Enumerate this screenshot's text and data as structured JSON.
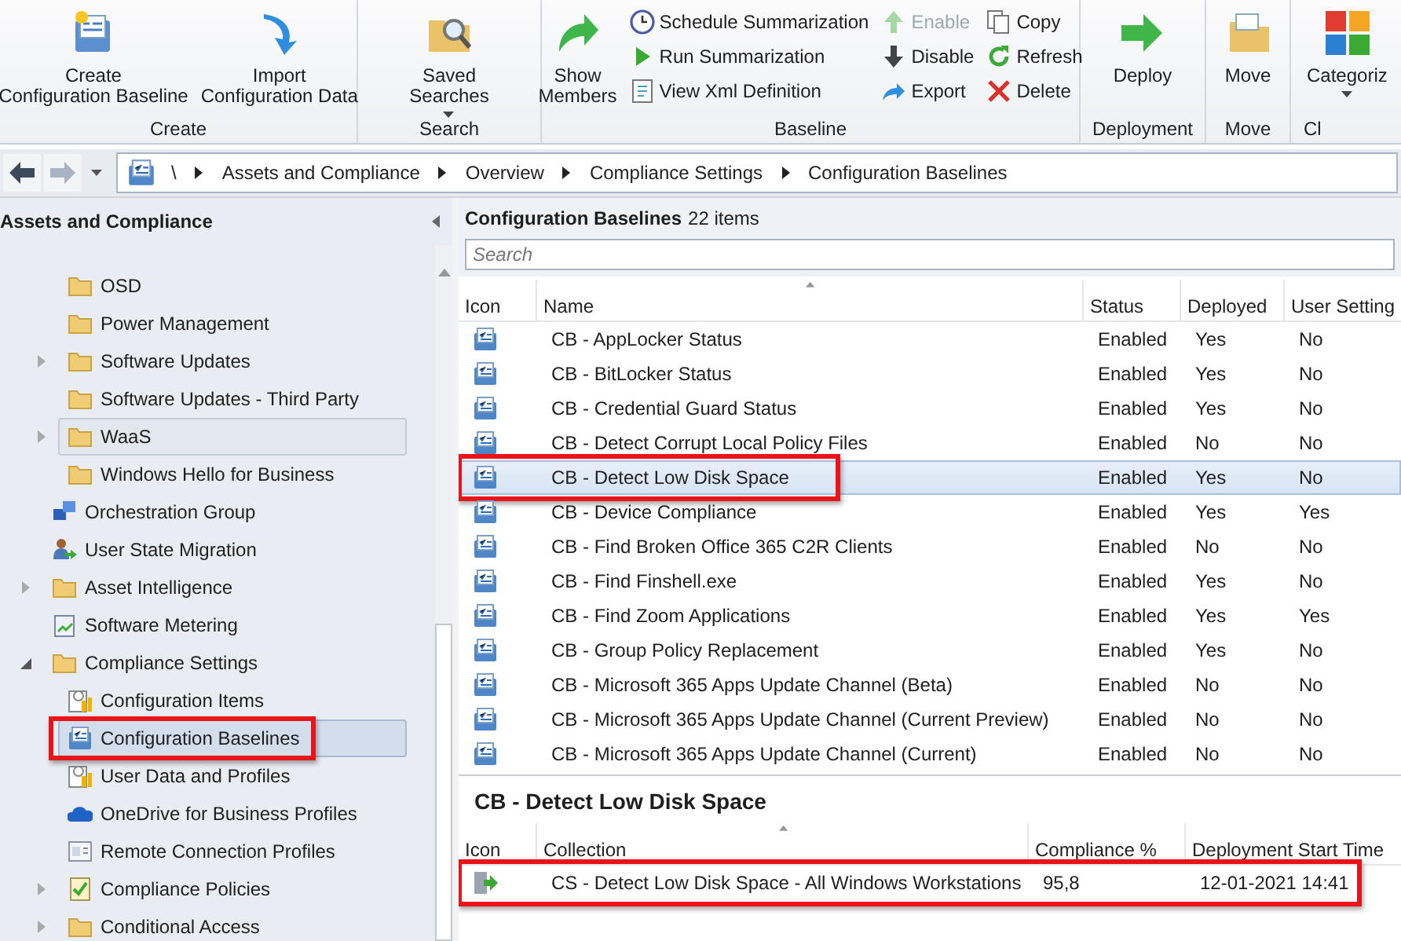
{
  "ribbon": {
    "groups": [
      {
        "label": "Create",
        "buttons": [
          {
            "label": "Create\nConfiguration Baseline",
            "kind": "large",
            "disabled": false,
            "dropdown": false
          },
          {
            "label": "Import\nConfiguration Data",
            "kind": "large",
            "disabled": false,
            "dropdown": false
          }
        ]
      },
      {
        "label": "Search",
        "buttons": [
          {
            "label": "Saved\nSearches",
            "kind": "large",
            "disabled": false,
            "dropdown": true
          }
        ]
      },
      {
        "label": "Baseline",
        "buttons": [
          {
            "label": "Show\nMembers",
            "kind": "large",
            "disabled": false,
            "dropdown": false
          },
          {
            "label": "Schedule Summarization",
            "kind": "small",
            "disabled": false,
            "dropdown": false
          },
          {
            "label": "Run Summarization",
            "kind": "small",
            "disabled": false,
            "dropdown": false
          },
          {
            "label": "View Xml Definition",
            "kind": "small",
            "disabled": false,
            "dropdown": false
          },
          {
            "label": "Enable",
            "kind": "small",
            "disabled": true,
            "dropdown": false
          },
          {
            "label": "Disable",
            "kind": "small",
            "disabled": false,
            "dropdown": false
          },
          {
            "label": "Export",
            "kind": "small",
            "disabled": false,
            "dropdown": false
          },
          {
            "label": "Copy",
            "kind": "small",
            "disabled": false,
            "dropdown": false
          },
          {
            "label": "Refresh",
            "kind": "small",
            "disabled": false,
            "dropdown": false
          },
          {
            "label": "Delete",
            "kind": "small",
            "disabled": false,
            "dropdown": false
          }
        ]
      },
      {
        "label": "Deployment",
        "buttons": [
          {
            "label": "Deploy",
            "kind": "large",
            "disabled": false,
            "dropdown": false
          }
        ]
      },
      {
        "label": "Move",
        "buttons": [
          {
            "label": "Move",
            "kind": "large",
            "disabled": false,
            "dropdown": false
          }
        ]
      },
      {
        "label": "Cl",
        "buttons": [
          {
            "label": "Categoriz",
            "kind": "large",
            "disabled": false,
            "dropdown": true
          }
        ]
      }
    ]
  },
  "navigation": {
    "breadcrumb": [
      "\\",
      "Assets and Compliance",
      "Overview",
      "Compliance Settings",
      "Configuration Baselines"
    ]
  },
  "tree": {
    "title": "Assets and Compliance",
    "items": [
      {
        "children": [
          {
            "label": "OSD",
            "kind": "folder",
            "selected": false,
            "hovered": false,
            "annotated": false
          },
          {
            "label": "Power Management",
            "kind": "folder",
            "selected": false,
            "hovered": false,
            "annotated": false
          },
          {
            "label": "Software Updates",
            "kind": "folder",
            "expanded": false,
            "selected": false,
            "hovered": false,
            "annotated": false
          },
          {
            "label": "Software Updates - Third Party",
            "kind": "folder",
            "selected": false,
            "hovered": false,
            "annotated": false
          },
          {
            "label": "WaaS",
            "kind": "folder",
            "expanded": false,
            "selected": false,
            "hovered": true,
            "annotated": false
          },
          {
            "label": "Windows Hello for Business",
            "kind": "folder",
            "selected": false,
            "hovered": false,
            "annotated": false
          }
        ]
      },
      {
        "label": "Orchestration Group",
        "kind": "orchestration",
        "selected": false,
        "hovered": false,
        "annotated": false
      },
      {
        "label": "User State Migration",
        "kind": "migration",
        "selected": false,
        "hovered": false,
        "annotated": false
      },
      {
        "label": "Asset Intelligence",
        "kind": "folder",
        "expanded": false,
        "selected": false,
        "hovered": false,
        "annotated": false
      },
      {
        "label": "Software Metering",
        "kind": "metering",
        "selected": false,
        "hovered": false,
        "annotated": false
      },
      {
        "label": "Compliance Settings",
        "kind": "folder",
        "expanded": true,
        "selected": false,
        "hovered": false,
        "annotated": false,
        "children": [
          {
            "label": "Configuration Items",
            "kind": "config-item",
            "selected": false,
            "hovered": false,
            "annotated": false
          },
          {
            "label": "Configuration Baselines",
            "kind": "baseline",
            "selected": true,
            "hovered": false,
            "annotated": true
          },
          {
            "label": "User Data and Profiles",
            "kind": "config-item",
            "selected": false,
            "hovered": false,
            "annotated": false
          },
          {
            "label": "OneDrive for Business Profiles",
            "kind": "cloud",
            "selected": false,
            "hovered": false,
            "annotated": false
          },
          {
            "label": "Remote Connection Profiles",
            "kind": "remote",
            "selected": false,
            "hovered": false,
            "annotated": false
          },
          {
            "label": "Compliance Policies",
            "kind": "policy",
            "expanded": false,
            "selected": false,
            "hovered": false,
            "annotated": false
          },
          {
            "label": "Conditional Access",
            "kind": "folder",
            "expanded": false,
            "selected": false,
            "hovered": false,
            "annotated": false
          }
        ]
      }
    ]
  },
  "list": {
    "title": "Configuration Baselines",
    "count": "22 items",
    "search": {
      "placeholder": "Search"
    },
    "columns": [
      {
        "label": "Icon",
        "sorted": false
      },
      {
        "label": "Name",
        "sorted": true
      },
      {
        "label": "Status",
        "sorted": false
      },
      {
        "label": "Deployed",
        "sorted": false
      },
      {
        "label": "User Setting",
        "sorted": false
      }
    ],
    "rows": [
      {
        "name": "CB - AppLocker Status",
        "status": "Enabled",
        "deployed": "Yes",
        "user_setting": "No",
        "selected": false,
        "annotated": false
      },
      {
        "name": "CB - BitLocker Status",
        "status": "Enabled",
        "deployed": "Yes",
        "user_setting": "No",
        "selected": false,
        "annotated": false
      },
      {
        "name": "CB - Credential Guard Status",
        "status": "Enabled",
        "deployed": "Yes",
        "user_setting": "No",
        "selected": false,
        "annotated": false
      },
      {
        "name": "CB - Detect Corrupt Local Policy Files",
        "status": "Enabled",
        "deployed": "No",
        "user_setting": "No",
        "selected": false,
        "annotated": false
      },
      {
        "name": "CB - Detect Low Disk Space",
        "status": "Enabled",
        "deployed": "Yes",
        "user_setting": "No",
        "selected": true,
        "annotated": true
      },
      {
        "name": "CB - Device Compliance",
        "status": "Enabled",
        "deployed": "Yes",
        "user_setting": "Yes",
        "selected": false,
        "annotated": false
      },
      {
        "name": "CB - Find Broken Office 365 C2R Clients",
        "status": "Enabled",
        "deployed": "No",
        "user_setting": "No",
        "selected": false,
        "annotated": false
      },
      {
        "name": "CB - Find Finshell.exe",
        "status": "Enabled",
        "deployed": "Yes",
        "user_setting": "No",
        "selected": false,
        "annotated": false
      },
      {
        "name": "CB - Find Zoom Applications",
        "status": "Enabled",
        "deployed": "Yes",
        "user_setting": "Yes",
        "selected": false,
        "annotated": false
      },
      {
        "name": "CB - Group Policy Replacement",
        "status": "Enabled",
        "deployed": "Yes",
        "user_setting": "No",
        "selected": false,
        "annotated": false
      },
      {
        "name": "CB - Microsoft 365 Apps Update Channel (Beta)",
        "status": "Enabled",
        "deployed": "No",
        "user_setting": "No",
        "selected": false,
        "annotated": false
      },
      {
        "name": "CB - Microsoft 365 Apps Update Channel (Current Preview)",
        "status": "Enabled",
        "deployed": "No",
        "user_setting": "No",
        "selected": false,
        "annotated": false
      },
      {
        "name": "CB - Microsoft 365 Apps Update Channel (Current)",
        "status": "Enabled",
        "deployed": "No",
        "user_setting": "No",
        "selected": false,
        "annotated": false
      }
    ]
  },
  "detail": {
    "title": "CB - Detect Low Disk Space",
    "columns": [
      {
        "label": "Icon",
        "sorted": false
      },
      {
        "label": "Collection",
        "sorted": true
      },
      {
        "label": "Compliance %",
        "sorted": false
      },
      {
        "label": "Deployment Start Time",
        "sorted": false
      }
    ],
    "rows": [
      {
        "collection": "CS - Detect Low Disk Space - All Windows Workstations",
        "compliance": "95,8",
        "start_time": "12-01-2021 14:41",
        "annotated": true
      }
    ]
  }
}
